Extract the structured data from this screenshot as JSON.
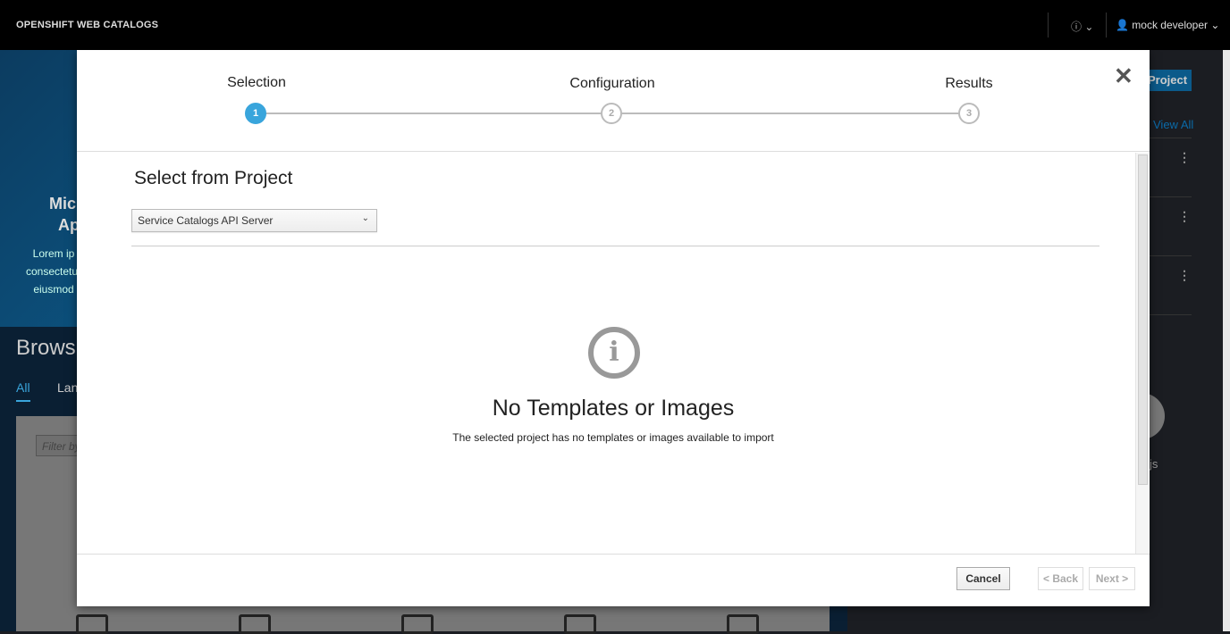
{
  "topbar": {
    "brand": "OPENSHIFT WEB CATALOGS",
    "help_icon": "question-circle-icon",
    "user": "mock developer"
  },
  "background": {
    "hero_title_1": "Mic",
    "hero_title_2": "Ap",
    "hero_text": [
      "Lorem ip",
      "consectetur",
      "eiusmod"
    ],
    "browse": "Brows",
    "tabs": [
      "All",
      "Lan"
    ],
    "filter_placeholder": "Filter by",
    "project_button": "Project",
    "view_all": "View All",
    "js_label": "js"
  },
  "wizard": {
    "steps": [
      {
        "num": "1",
        "label": "Selection",
        "active": true
      },
      {
        "num": "2",
        "label": "Configuration"
      },
      {
        "num": "3",
        "label": "Results"
      }
    ],
    "title": "Select from Project",
    "project_select": "Service Catalogs API Server",
    "empty_title": "No Templates or Images",
    "empty_text": "The selected project has no templates or images available to import",
    "cancel": "Cancel",
    "back": "< Back",
    "next": "Next >"
  },
  "colors": {
    "accent": "#39a5dc",
    "topbar": "#000000"
  }
}
